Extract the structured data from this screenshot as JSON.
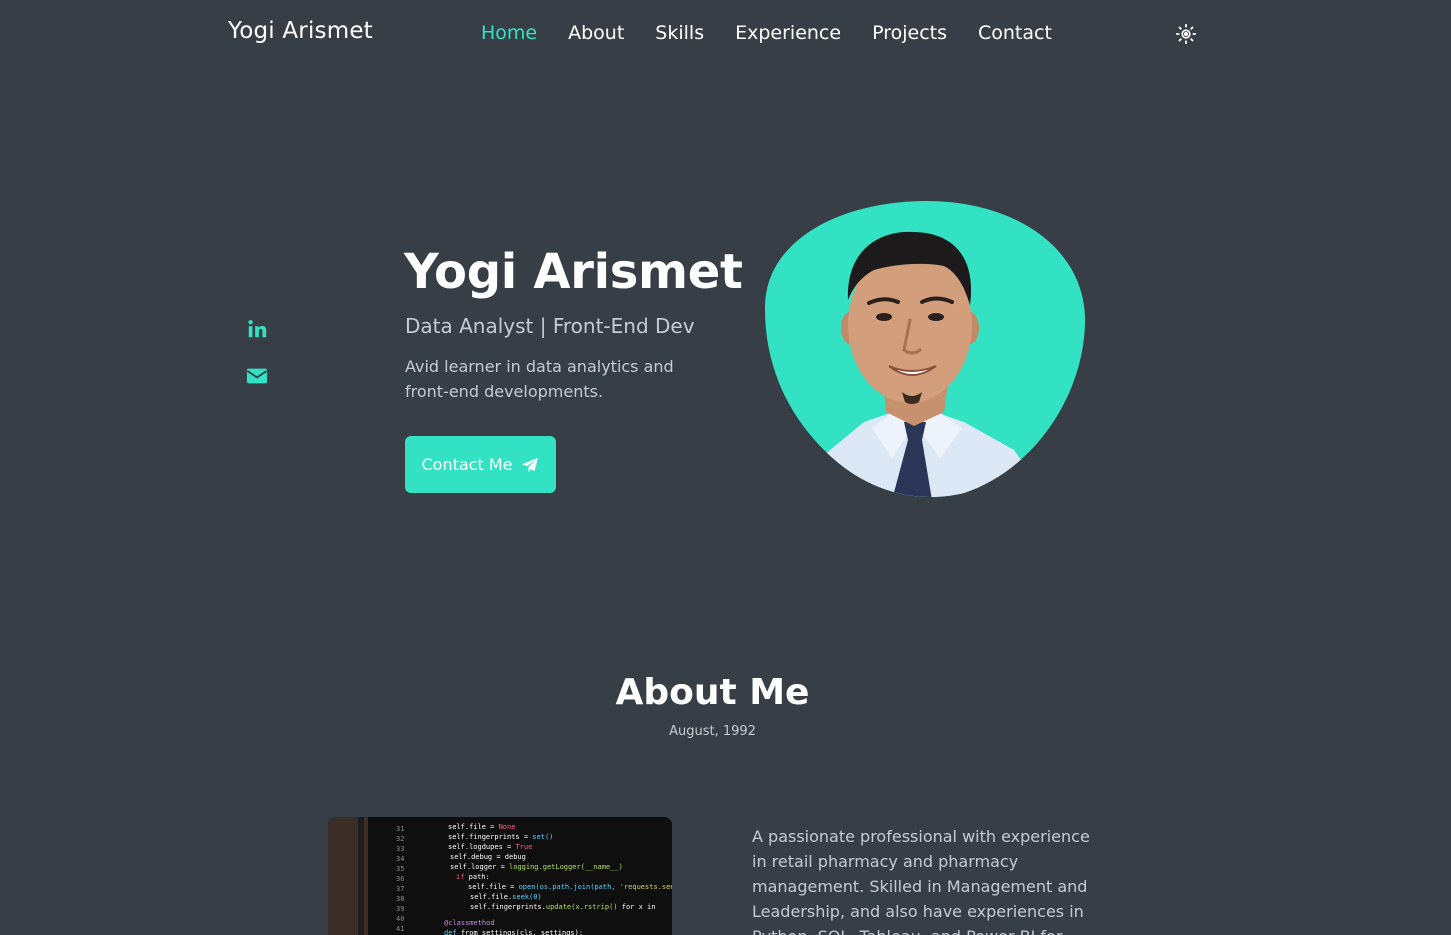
{
  "header": {
    "logo": "Yogi Arismet",
    "nav": [
      "Home",
      "About",
      "Skills",
      "Experience",
      "Projects",
      "Contact"
    ],
    "active_nav": "Home",
    "theme_icon": "sun-icon"
  },
  "social": {
    "items": [
      {
        "icon": "linkedin-icon"
      },
      {
        "icon": "envelope-icon"
      }
    ]
  },
  "hero": {
    "name": "Yogi Arismet",
    "subtitle": "Data Analyst | Front-End Dev",
    "description": "Avid learner in data analytics and front-end developments.",
    "button_label": "Contact Me",
    "button_icon": "paper-plane-icon"
  },
  "about": {
    "title": "About Me",
    "subtitle": "August, 1992",
    "text": "A passionate professional with experience in retail pharmacy and pharmacy management. Skilled in Management and Leadership, and also have experiences in Python, SQL, Tableau, and Power BI for Data"
  },
  "colors": {
    "background": "#383e46",
    "accent": "#33e2c3",
    "text": "#ffffff",
    "muted": "#c7cbd1"
  }
}
